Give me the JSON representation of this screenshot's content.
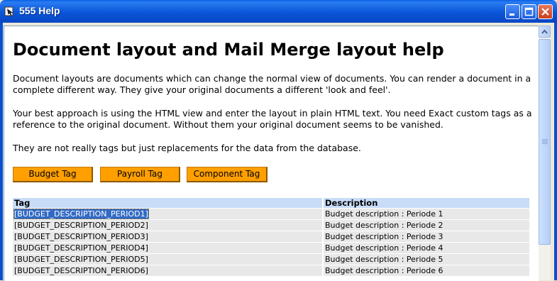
{
  "window": {
    "title": "555 Help"
  },
  "page": {
    "heading": "Document layout and Mail Merge layout help",
    "paragraphs": [
      "Document layouts are documents which can change the normal view of documents. You can render a document in a complete different way. They give your original documents a different 'look and feel'.",
      "Your best approach is using the HTML view and enter the layout in plain HTML text. You need Exact custom tags as a reference to the original document. Without them your original document seems to be vanished.",
      "They are not really tags but just replacements for the data from the database."
    ],
    "buttons": [
      "Budget Tag",
      "Payroll Tag",
      "Component Tag"
    ]
  },
  "table": {
    "headers": [
      "Tag",
      "Description"
    ],
    "rows": [
      [
        "[BUDGET_DESCRIPTION_PERIOD1]",
        "Budget description : Periode 1"
      ],
      [
        "[BUDGET_DESCRIPTION_PERIOD2]",
        "Budget description : Periode 2"
      ],
      [
        "[BUDGET_DESCRIPTION_PERIOD3]",
        "Budget description : Periode 3"
      ],
      [
        "[BUDGET_DESCRIPTION_PERIOD4]",
        "Budget description : Periode 4"
      ],
      [
        "[BUDGET_DESCRIPTION_PERIOD5]",
        "Budget description : Periode 5"
      ],
      [
        "[BUDGET_DESCRIPTION_PERIOD6]",
        "Budget description : Periode 6"
      ]
    ]
  },
  "colors": {
    "titlebar": "#0a55d8",
    "tag_button": "#ff9f00",
    "table_header": "#c8dcf8",
    "table_row": "#e8e8e8",
    "selection": "#316ac5"
  },
  "icons": [
    "app-icon",
    "minimize-icon",
    "maximize-icon",
    "close-icon",
    "scroll-up-arrow-icon"
  ]
}
